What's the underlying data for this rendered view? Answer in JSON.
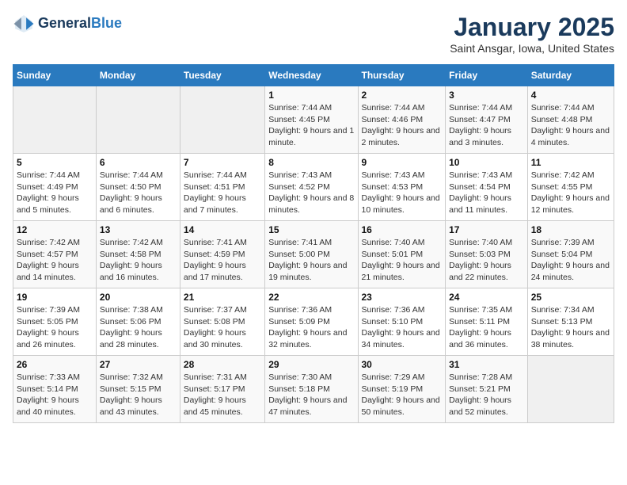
{
  "app": {
    "logo_line1": "General",
    "logo_line2": "Blue"
  },
  "calendar": {
    "title": "January 2025",
    "subtitle": "Saint Ansgar, Iowa, United States"
  },
  "headers": [
    "Sunday",
    "Monday",
    "Tuesday",
    "Wednesday",
    "Thursday",
    "Friday",
    "Saturday"
  ],
  "weeks": [
    [
      {
        "day": "",
        "info": ""
      },
      {
        "day": "",
        "info": ""
      },
      {
        "day": "",
        "info": ""
      },
      {
        "day": "1",
        "info": "Sunrise: 7:44 AM\nSunset: 4:45 PM\nDaylight: 9 hours and 1 minute."
      },
      {
        "day": "2",
        "info": "Sunrise: 7:44 AM\nSunset: 4:46 PM\nDaylight: 9 hours and 2 minutes."
      },
      {
        "day": "3",
        "info": "Sunrise: 7:44 AM\nSunset: 4:47 PM\nDaylight: 9 hours and 3 minutes."
      },
      {
        "day": "4",
        "info": "Sunrise: 7:44 AM\nSunset: 4:48 PM\nDaylight: 9 hours and 4 minutes."
      }
    ],
    [
      {
        "day": "5",
        "info": "Sunrise: 7:44 AM\nSunset: 4:49 PM\nDaylight: 9 hours and 5 minutes."
      },
      {
        "day": "6",
        "info": "Sunrise: 7:44 AM\nSunset: 4:50 PM\nDaylight: 9 hours and 6 minutes."
      },
      {
        "day": "7",
        "info": "Sunrise: 7:44 AM\nSunset: 4:51 PM\nDaylight: 9 hours and 7 minutes."
      },
      {
        "day": "8",
        "info": "Sunrise: 7:43 AM\nSunset: 4:52 PM\nDaylight: 9 hours and 8 minutes."
      },
      {
        "day": "9",
        "info": "Sunrise: 7:43 AM\nSunset: 4:53 PM\nDaylight: 9 hours and 10 minutes."
      },
      {
        "day": "10",
        "info": "Sunrise: 7:43 AM\nSunset: 4:54 PM\nDaylight: 9 hours and 11 minutes."
      },
      {
        "day": "11",
        "info": "Sunrise: 7:42 AM\nSunset: 4:55 PM\nDaylight: 9 hours and 12 minutes."
      }
    ],
    [
      {
        "day": "12",
        "info": "Sunrise: 7:42 AM\nSunset: 4:57 PM\nDaylight: 9 hours and 14 minutes."
      },
      {
        "day": "13",
        "info": "Sunrise: 7:42 AM\nSunset: 4:58 PM\nDaylight: 9 hours and 16 minutes."
      },
      {
        "day": "14",
        "info": "Sunrise: 7:41 AM\nSunset: 4:59 PM\nDaylight: 9 hours and 17 minutes."
      },
      {
        "day": "15",
        "info": "Sunrise: 7:41 AM\nSunset: 5:00 PM\nDaylight: 9 hours and 19 minutes."
      },
      {
        "day": "16",
        "info": "Sunrise: 7:40 AM\nSunset: 5:01 PM\nDaylight: 9 hours and 21 minutes."
      },
      {
        "day": "17",
        "info": "Sunrise: 7:40 AM\nSunset: 5:03 PM\nDaylight: 9 hours and 22 minutes."
      },
      {
        "day": "18",
        "info": "Sunrise: 7:39 AM\nSunset: 5:04 PM\nDaylight: 9 hours and 24 minutes."
      }
    ],
    [
      {
        "day": "19",
        "info": "Sunrise: 7:39 AM\nSunset: 5:05 PM\nDaylight: 9 hours and 26 minutes."
      },
      {
        "day": "20",
        "info": "Sunrise: 7:38 AM\nSunset: 5:06 PM\nDaylight: 9 hours and 28 minutes."
      },
      {
        "day": "21",
        "info": "Sunrise: 7:37 AM\nSunset: 5:08 PM\nDaylight: 9 hours and 30 minutes."
      },
      {
        "day": "22",
        "info": "Sunrise: 7:36 AM\nSunset: 5:09 PM\nDaylight: 9 hours and 32 minutes."
      },
      {
        "day": "23",
        "info": "Sunrise: 7:36 AM\nSunset: 5:10 PM\nDaylight: 9 hours and 34 minutes."
      },
      {
        "day": "24",
        "info": "Sunrise: 7:35 AM\nSunset: 5:11 PM\nDaylight: 9 hours and 36 minutes."
      },
      {
        "day": "25",
        "info": "Sunrise: 7:34 AM\nSunset: 5:13 PM\nDaylight: 9 hours and 38 minutes."
      }
    ],
    [
      {
        "day": "26",
        "info": "Sunrise: 7:33 AM\nSunset: 5:14 PM\nDaylight: 9 hours and 40 minutes."
      },
      {
        "day": "27",
        "info": "Sunrise: 7:32 AM\nSunset: 5:15 PM\nDaylight: 9 hours and 43 minutes."
      },
      {
        "day": "28",
        "info": "Sunrise: 7:31 AM\nSunset: 5:17 PM\nDaylight: 9 hours and 45 minutes."
      },
      {
        "day": "29",
        "info": "Sunrise: 7:30 AM\nSunset: 5:18 PM\nDaylight: 9 hours and 47 minutes."
      },
      {
        "day": "30",
        "info": "Sunrise: 7:29 AM\nSunset: 5:19 PM\nDaylight: 9 hours and 50 minutes."
      },
      {
        "day": "31",
        "info": "Sunrise: 7:28 AM\nSunset: 5:21 PM\nDaylight: 9 hours and 52 minutes."
      },
      {
        "day": "",
        "info": ""
      }
    ]
  ]
}
